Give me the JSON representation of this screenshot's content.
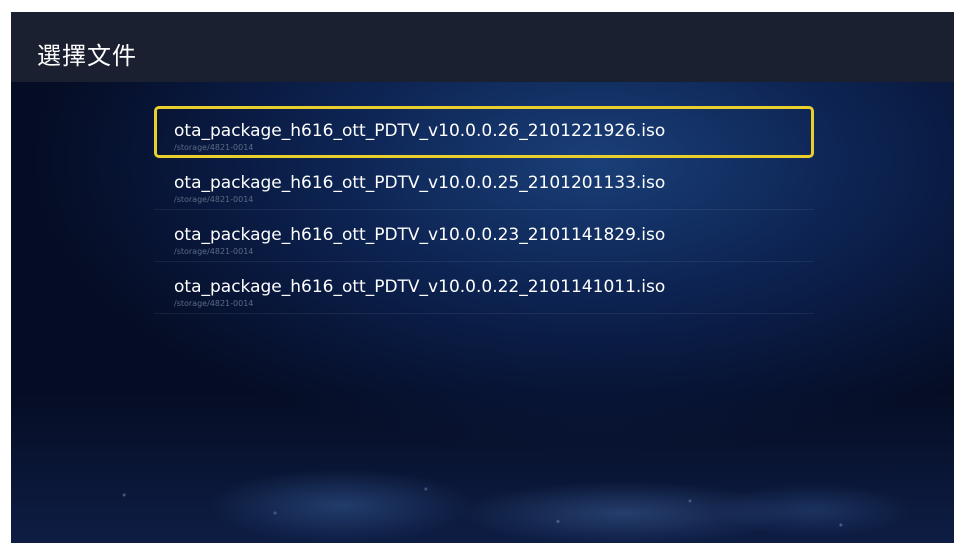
{
  "header": {
    "title": "選擇文件"
  },
  "files": [
    {
      "name": "ota_package_h616_ott_PDTV_v10.0.0.26_2101221926.iso",
      "path": "/storage/4821-0014",
      "selected": true
    },
    {
      "name": "ota_package_h616_ott_PDTV_v10.0.0.25_2101201133.iso",
      "path": "/storage/4821-0014",
      "selected": false
    },
    {
      "name": "ota_package_h616_ott_PDTV_v10.0.0.23_2101141829.iso",
      "path": "/storage/4821-0014",
      "selected": false
    },
    {
      "name": "ota_package_h616_ott_PDTV_v10.0.0.22_2101141011.iso",
      "path": "/storage/4821-0014",
      "selected": false
    }
  ],
  "colors": {
    "focus_border": "#e8cf2d",
    "header_bg": "#1b2030",
    "background": "#0d2453"
  }
}
